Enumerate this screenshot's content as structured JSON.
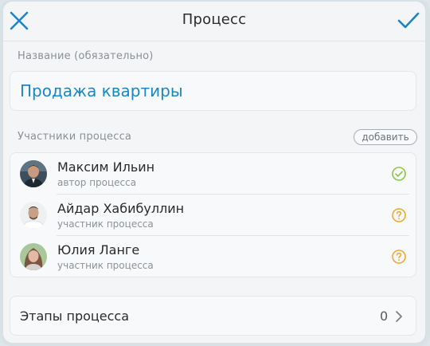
{
  "navbar": {
    "title": "Процесс"
  },
  "name_section": {
    "label": "Название (обязательно)",
    "value": "Продажа квартиры"
  },
  "participants": {
    "label": "Участники процесса",
    "add_label": "добавить",
    "members": [
      {
        "name": "Максим Ильин",
        "role": "автор процесса",
        "status": "confirmed",
        "status_icon": "check-circle-icon"
      },
      {
        "name": "Айдар Хабибуллин",
        "role": "участник процесса",
        "status": "pending",
        "status_icon": "question-circle-icon"
      },
      {
        "name": "Юлия Ланге",
        "role": "участник процесса",
        "status": "pending",
        "status_icon": "question-circle-icon"
      }
    ]
  },
  "stages": {
    "label": "Этапы процесса",
    "count": "0"
  },
  "colors": {
    "accent": "#1a86c8",
    "confirmed": "#8cc63f",
    "pending": "#f0a830"
  }
}
